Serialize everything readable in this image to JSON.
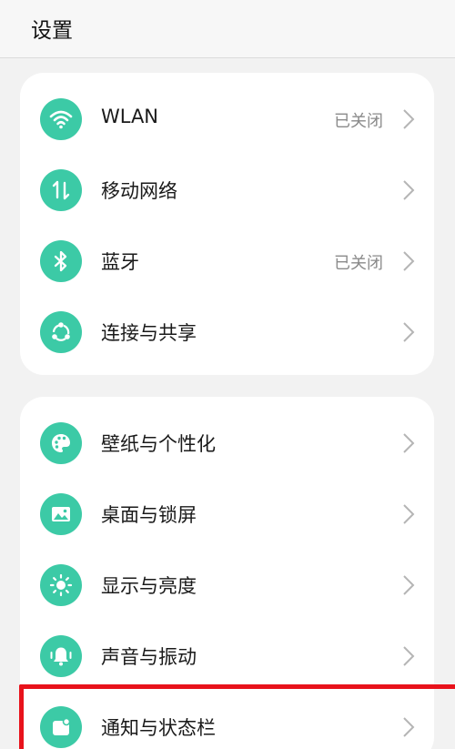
{
  "header": {
    "title": "设置"
  },
  "connectivity": {
    "wlan": {
      "label": "WLAN",
      "status": "已关闭",
      "icon": "wifi-icon"
    },
    "mobile": {
      "label": "移动网络",
      "icon": "mobile-data-icon"
    },
    "bluetooth": {
      "label": "蓝牙",
      "status": "已关闭",
      "icon": "bluetooth-icon"
    },
    "sharing": {
      "label": "连接与共享",
      "icon": "share-icon"
    }
  },
  "personalization": {
    "wallpaper": {
      "label": "壁纸与个性化",
      "icon": "palette-icon"
    },
    "desktop": {
      "label": "桌面与锁屏",
      "icon": "image-icon"
    },
    "display": {
      "label": "显示与亮度",
      "icon": "brightness-icon"
    },
    "sound": {
      "label": "声音与振动",
      "icon": "bell-icon"
    },
    "notifications": {
      "label": "通知与状态栏",
      "icon": "notification-icon"
    }
  },
  "colors": {
    "accent": "#3ccaa6",
    "highlight": "#e8121b"
  }
}
